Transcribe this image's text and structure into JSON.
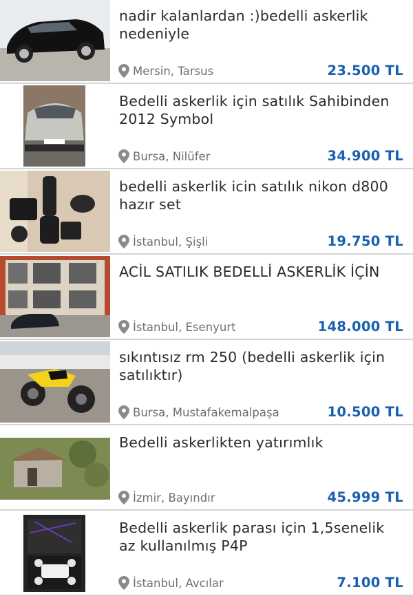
{
  "listings": [
    {
      "title": "nadir kalanlardan :)bedelli askerlik nedeniyle",
      "location": "Mersin, Tarsus",
      "price": "23.500 TL",
      "thumb_icon": "black-hatchback-photo"
    },
    {
      "title": "Bedelli askerlik için satılık Sahibinden 2012 Symbol",
      "location": "Bursa, Nilüfer",
      "price": "34.900 TL",
      "thumb_icon": "silver-sedan-photo"
    },
    {
      "title": "bedelli askerlik icin satılık nikon d800 hazır set",
      "location": "İstanbul, Şişli",
      "price": "19.750 TL",
      "thumb_icon": "camera-lenses-photo"
    },
    {
      "title": "ACİL SATILIK BEDELLİ ASKERLİK İÇİN",
      "location": "İstanbul, Esenyurt",
      "price": "148.000 TL",
      "thumb_icon": "apartment-building-photo"
    },
    {
      "title": "sıkıntısız rm 250 (bedelli askerlik için satılıktır)",
      "location": "Bursa, Mustafakemalpaşa",
      "price": "10.500 TL",
      "thumb_icon": "yellow-motorbike-photo"
    },
    {
      "title": "Bedelli askerlikten yatırımlık",
      "location": "İzmir, Bayındır",
      "price": "45.999 TL",
      "thumb_icon": "old-house-land-photo"
    },
    {
      "title": "Bedelli askerlik parası için 1,5senelik az kullanılmış P4P",
      "location": "İstanbul, Avcılar",
      "price": "7.100 TL",
      "thumb_icon": "drone-case-photo"
    }
  ],
  "colors": {
    "price": "#1b5fb0",
    "location": "#6f6f6f",
    "divider": "#d4d4d4"
  }
}
